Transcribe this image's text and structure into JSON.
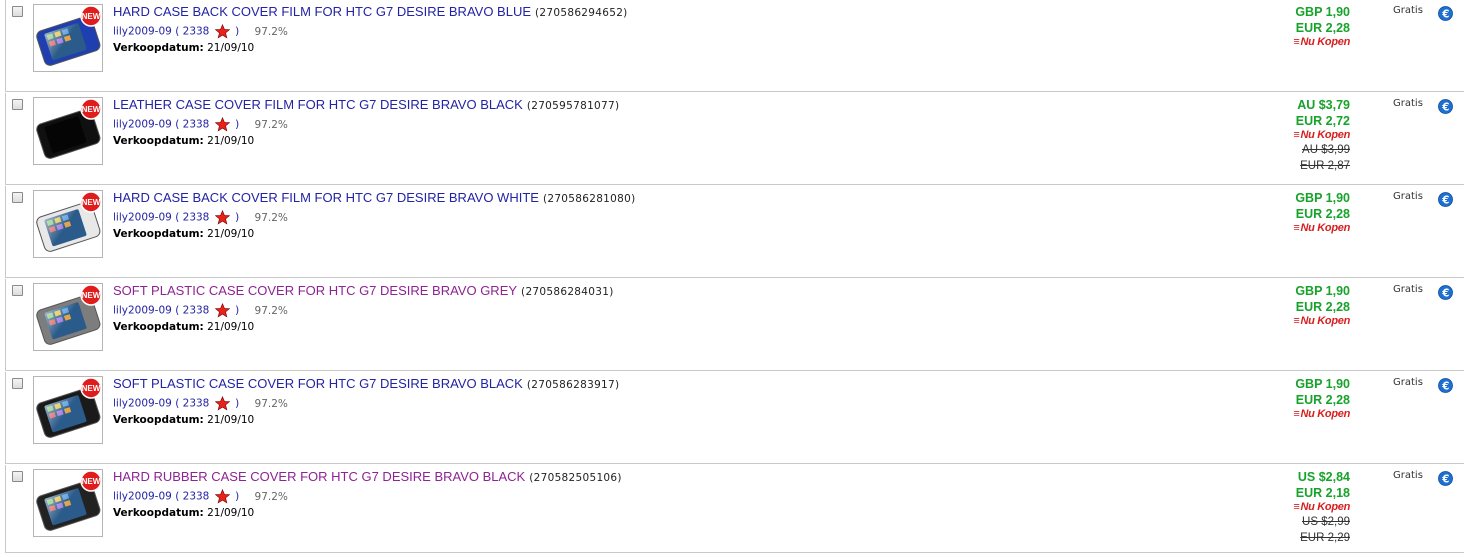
{
  "listings": [
    {
      "title": "HARD CASE BACK COVER FILM FOR HTC G7 DESIRE BRAVO BLUE",
      "item_number": "(270586294652)",
      "visited": false,
      "seller": "lily2009-09",
      "feedback_open": "(",
      "feedback_score": "2338",
      "feedback_close": ")",
      "feedback_percent": "97.2%",
      "sale_date_label": "Verkoopdatum:",
      "sale_date": "21/09/10",
      "price_1": "GBP 1,90",
      "price_2": "EUR 2,28",
      "buy_now": "Nu Kopen",
      "old_price_1": "",
      "old_price_2": "",
      "shipping": "Gratis",
      "thumb_icon": "phone-case-blue-icon",
      "thumb_badge": "NEW"
    },
    {
      "title": "LEATHER CASE COVER FILM FOR HTC G7 DESIRE BRAVO BLACK",
      "item_number": "(270595781077)",
      "visited": false,
      "seller": "lily2009-09",
      "feedback_open": "(",
      "feedback_score": "2338",
      "feedback_close": ")",
      "feedback_percent": "97.2%",
      "sale_date_label": "Verkoopdatum:",
      "sale_date": "21/09/10",
      "price_1": "AU $3,79",
      "price_2": "EUR 2,72",
      "buy_now": "Nu Kopen",
      "old_price_1": "AU $3,99",
      "old_price_2": "EUR 2,87",
      "shipping": "Gratis",
      "thumb_icon": "leather-case-icon",
      "thumb_badge": "NEW"
    },
    {
      "title": "HARD CASE BACK COVER FILM FOR HTC G7 DESIRE BRAVO WHITE",
      "item_number": "(270586281080)",
      "visited": false,
      "seller": "lily2009-09",
      "feedback_open": "(",
      "feedback_score": "2338",
      "feedback_close": ")",
      "feedback_percent": "97.2%",
      "sale_date_label": "Verkoopdatum:",
      "sale_date": "21/09/10",
      "price_1": "GBP 1,90",
      "price_2": "EUR 2,28",
      "buy_now": "Nu Kopen",
      "old_price_1": "",
      "old_price_2": "",
      "shipping": "Gratis",
      "thumb_icon": "phone-case-white-icon",
      "thumb_badge": "NEW"
    },
    {
      "title": "SOFT PLASTIC CASE COVER FOR HTC G7 DESIRE BRAVO GREY",
      "item_number": "(270586284031)",
      "visited": true,
      "seller": "lily2009-09",
      "feedback_open": "(",
      "feedback_score": "2338",
      "feedback_close": ")",
      "feedback_percent": "97.2%",
      "sale_date_label": "Verkoopdatum:",
      "sale_date": "21/09/10",
      "price_1": "GBP 1,90",
      "price_2": "EUR 2,28",
      "buy_now": "Nu Kopen",
      "old_price_1": "",
      "old_price_2": "",
      "shipping": "Gratis",
      "thumb_icon": "phone-case-grey-icon",
      "thumb_badge": "NEW"
    },
    {
      "title": "SOFT PLASTIC CASE COVER FOR HTC G7 DESIRE BRAVO BLACK",
      "item_number": "(270586283917)",
      "visited": false,
      "seller": "lily2009-09",
      "feedback_open": "(",
      "feedback_score": "2338",
      "feedback_close": ")",
      "feedback_percent": "97.2%",
      "sale_date_label": "Verkoopdatum:",
      "sale_date": "21/09/10",
      "price_1": "GBP 1,90",
      "price_2": "EUR 2,28",
      "buy_now": "Nu Kopen",
      "old_price_1": "",
      "old_price_2": "",
      "shipping": "Gratis",
      "thumb_icon": "phone-case-black-icon",
      "thumb_badge": "NEW"
    },
    {
      "title": "HARD RUBBER CASE COVER FOR HTC G7 DESIRE BRAVO BLACK",
      "item_number": "(270582505106)",
      "visited": true,
      "seller": "lily2009-09",
      "feedback_open": "(",
      "feedback_score": "2338",
      "feedback_close": ")",
      "feedback_percent": "97.2%",
      "sale_date_label": "Verkoopdatum:",
      "sale_date": "21/09/10",
      "price_1": "US $2,84",
      "price_2": "EUR 2,18",
      "buy_now": "Nu Kopen",
      "old_price_1": "US $2,99",
      "old_price_2": "EUR 2,29",
      "shipping": "Gratis",
      "thumb_icon": "phone-case-rubber-icon",
      "thumb_badge": "NEW"
    }
  ],
  "colors": {
    "title_link": "#2323a5",
    "title_visited": "#8e2393",
    "price": "#17a22a",
    "buy_now": "#d61f1f",
    "star": "#e8221b",
    "badge": "#e01d1d"
  },
  "icons": {
    "feedback_star": "red-star-icon",
    "shipping_icon": "euro-icon",
    "checkbox": "checkbox"
  }
}
